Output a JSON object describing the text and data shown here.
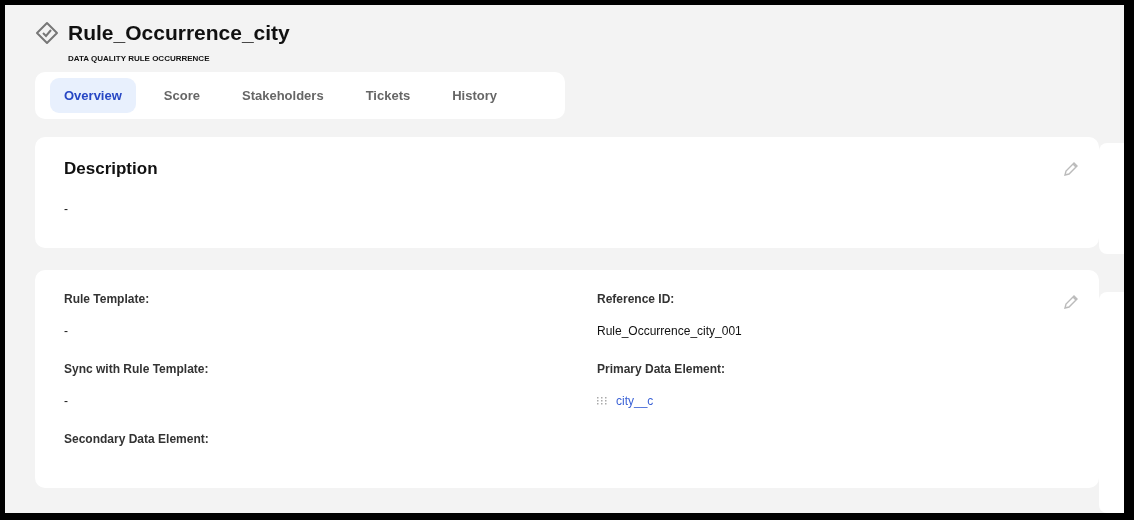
{
  "header": {
    "title": "Rule_Occurrence_city",
    "subtitle": "DATA QUALITY RULE OCCURRENCE"
  },
  "tabs": [
    {
      "label": "Overview",
      "selected": true
    },
    {
      "label": "Score",
      "selected": false
    },
    {
      "label": "Stakeholders",
      "selected": false
    },
    {
      "label": "Tickets",
      "selected": false
    },
    {
      "label": "History",
      "selected": false
    }
  ],
  "description": {
    "title": "Description",
    "value": "-"
  },
  "details": {
    "fields": [
      {
        "label": "Rule Template:",
        "kind": "text",
        "value": "-"
      },
      {
        "label": "Reference ID:",
        "kind": "text",
        "value": "Rule_Occurrence_city_001"
      },
      {
        "label": "Sync with Rule Template:",
        "kind": "text",
        "value": "-"
      },
      {
        "label": "Primary Data Element:",
        "kind": "link",
        "value": "city__c"
      },
      {
        "label": "Secondary Data Element:",
        "kind": "empty"
      }
    ]
  }
}
